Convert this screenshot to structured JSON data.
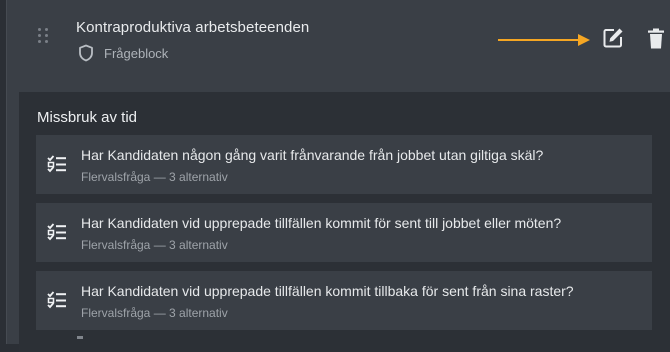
{
  "block": {
    "title": "Kontraproduktiva arbetsbeteenden",
    "type_label": "Frågeblock",
    "type_icon": "shield-icon",
    "actions": {
      "edit_icon": "edit-icon",
      "delete_icon": "trash-icon",
      "arrow_color": "#f5a623"
    }
  },
  "section": {
    "title": "Missbruk av tid",
    "questions": [
      {
        "text": "Har Kandidaten någon gång varit frånvarande från jobbet utan giltiga skäl?",
        "meta": "Flervalsfråga — 3 alternativ",
        "icon": "checklist-icon"
      },
      {
        "text": "Har Kandidaten vid upprepade tillfällen kommit för sent till jobbet eller möten?",
        "meta": "Flervalsfråga — 3 alternativ",
        "icon": "checklist-icon"
      },
      {
        "text": "Har Kandidaten vid upprepade tillfällen kommit tillbaka för sent från sina raster?",
        "meta": "Flervalsfråga — 3 alternativ",
        "icon": "checklist-icon"
      }
    ]
  },
  "colors": {
    "background": "#2b2f35",
    "card": "#3a3f46",
    "panel": "#2c3036",
    "accent_arrow": "#f5a623"
  }
}
